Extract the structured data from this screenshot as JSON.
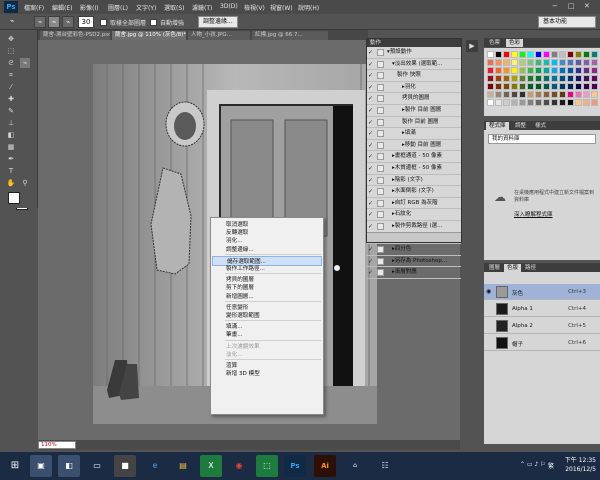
{
  "app": {
    "logo": "Ps",
    "menus": [
      "檔案(F)",
      "編輯(E)",
      "影像(I)",
      "圖層(L)",
      "文字(Y)",
      "選取(S)",
      "濾鏡(T)",
      "3D(D)",
      "檢視(V)",
      "視窗(W)",
      "說明(H)"
    ],
    "window_controls": [
      "−",
      "□",
      "✕"
    ]
  },
  "options": {
    "size": "30",
    "sample_all": "取樣全部圖層",
    "auto_enhance": "自動增強",
    "refine_edge": "調整邊緣...",
    "workspace": "基本功能"
  },
  "tabs": [
    "薩舍-濕台壁彩色-PSD2.psd",
    "薩舍.jpg @ 110% (灰色/8)* ×",
    "人物_小孩.JPG...",
    "紅標.jpg @ 66.7..."
  ],
  "status": {
    "zoom": "110%"
  },
  "actions_panel": {
    "title": "動作",
    "rows": [
      {
        "label": "預設動作",
        "indent": 0,
        "prefix": "▾"
      },
      {
        "label": "淡出效果 (選取範...",
        "indent": 1,
        "prefix": "▾"
      },
      {
        "label": "製作 快照",
        "indent": 2,
        "prefix": ""
      },
      {
        "label": "羽化",
        "indent": 3,
        "prefix": "▸"
      },
      {
        "label": "拷貝的圖層",
        "indent": 3,
        "prefix": ""
      },
      {
        "label": "製作 目前 圖層",
        "indent": 3,
        "prefix": "▸"
      },
      {
        "label": "製作 目前 圖層",
        "indent": 3,
        "prefix": ""
      },
      {
        "label": "填滿",
        "indent": 3,
        "prefix": "▸"
      },
      {
        "label": "移動 目前 圖層",
        "indent": 3,
        "prefix": "▸"
      },
      {
        "label": "畫框通道 - 50 像素",
        "indent": 1,
        "prefix": "▸"
      },
      {
        "label": "木質邊框 - 50 像素",
        "indent": 1,
        "prefix": "▸"
      },
      {
        "label": "陰影 (文字)",
        "indent": 1,
        "prefix": "▸"
      },
      {
        "label": "水面倒影 (文字)",
        "indent": 1,
        "prefix": "▸"
      },
      {
        "label": "自訂 RGB 為灰階",
        "indent": 1,
        "prefix": "▸"
      },
      {
        "label": "石紋化",
        "indent": 1,
        "prefix": "▸"
      },
      {
        "label": "製作剪裁路徑 (選...",
        "indent": 1,
        "prefix": "▸"
      },
      {
        "label": "深褐色調 (圖層)",
        "indent": 1,
        "prefix": "▸"
      },
      {
        "label": "四分色",
        "indent": 1,
        "prefix": "▸"
      },
      {
        "label": "另存為 Photoshop...",
        "indent": 1,
        "prefix": "▸"
      },
      {
        "label": "漸層對應",
        "indent": 1,
        "prefix": "▸"
      }
    ]
  },
  "panels": {
    "swatch_tabs": [
      "色票",
      "色彩"
    ],
    "lib_tabs": [
      "程式庫",
      "調整",
      "樣式"
    ],
    "lib_dropdown": "我的資料庫",
    "lib_message": "在桌機應用程式中建立新文件檔案到資料庫",
    "lib_link": "深入瞭解程式庫",
    "layer_tabs": [
      "圖層",
      "色版",
      "路徑"
    ],
    "layers": [
      {
        "name": "灰色",
        "key": "Ctrl+3",
        "selected": true,
        "thumb": "#9a9a9a"
      },
      {
        "name": "Alpha 1",
        "key": "Ctrl+4",
        "selected": false,
        "thumb": "#1a1a1a"
      },
      {
        "name": "Alpha 2",
        "key": "Ctrl+5",
        "selected": false,
        "thumb": "#222222"
      },
      {
        "name": "帽子",
        "key": "Ctrl+6",
        "selected": false,
        "thumb": "#111111"
      }
    ]
  },
  "context_menu": {
    "items": [
      {
        "label": "取消選取",
        "disabled": false,
        "highlighted": false
      },
      {
        "label": "反轉選取",
        "disabled": false,
        "highlighted": false
      },
      {
        "label": "羽化...",
        "disabled": false,
        "highlighted": false
      },
      {
        "label": "調整邊緣...",
        "disabled": false,
        "highlighted": false
      },
      {
        "sep": true
      },
      {
        "label": "儲存選取範圍...",
        "disabled": false,
        "highlighted": true
      },
      {
        "label": "製作工作路徑...",
        "disabled": false,
        "highlighted": false
      },
      {
        "sep": true
      },
      {
        "label": "拷貝的圖層",
        "disabled": false,
        "highlighted": false
      },
      {
        "label": "剪下的圖層",
        "disabled": false,
        "highlighted": false
      },
      {
        "label": "新增圖層...",
        "disabled": false,
        "highlighted": false
      },
      {
        "sep": true
      },
      {
        "label": "任意變形",
        "disabled": false,
        "highlighted": false
      },
      {
        "label": "變形選取範圍",
        "disabled": false,
        "highlighted": false
      },
      {
        "sep": true
      },
      {
        "label": "填滿...",
        "disabled": false,
        "highlighted": false
      },
      {
        "label": "筆畫...",
        "disabled": false,
        "highlighted": false
      },
      {
        "sep": true
      },
      {
        "label": "上次濾鏡效果",
        "disabled": true,
        "highlighted": false
      },
      {
        "label": "淡化...",
        "disabled": true,
        "highlighted": false
      },
      {
        "sep": true
      },
      {
        "label": "渲算",
        "disabled": false,
        "highlighted": false
      },
      {
        "label": "新增 3D 模型",
        "disabled": false,
        "highlighted": false
      }
    ]
  },
  "taskbar": {
    "time": "下午 12:35",
    "date": "2016/12/5",
    "ime": "繁"
  },
  "colors": {
    "accent": "#36a3f3",
    "highlight": "#cfe0f6",
    "selected_layer": "#9fb3d8"
  }
}
